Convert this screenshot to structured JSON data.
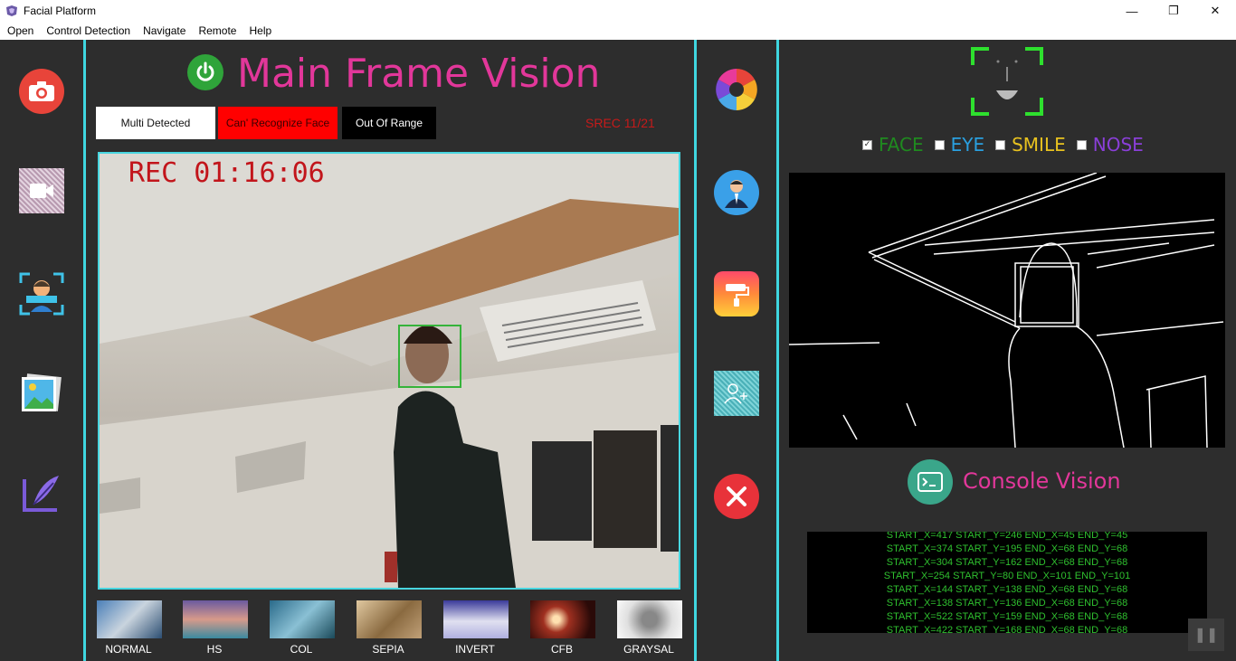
{
  "window": {
    "title": "Facial Platform",
    "minimize": "—",
    "maximize": "❐",
    "close": "✕"
  },
  "menu": [
    "Open",
    "Control Detection",
    "Navigate",
    "Remote",
    "Help"
  ],
  "main": {
    "title": "Main Frame Vision",
    "status": {
      "multi": "Multi Detected",
      "cant": "Can' Recognize Face",
      "range": "Out Of Range"
    },
    "srec": "SREC 11/21",
    "rec": "REC 01:16:06"
  },
  "filters": [
    "NORMAL",
    "HS",
    "COL",
    "SEPIA",
    "INVERT",
    "CFB",
    "GRAYSAL"
  ],
  "right": {
    "checks": [
      {
        "label": "FACE",
        "checked": true,
        "color": "#1f8a1f"
      },
      {
        "label": "EYE",
        "checked": false,
        "color": "#2aa0e0"
      },
      {
        "label": "SMILE",
        "checked": false,
        "color": "#e8c21f"
      },
      {
        "label": "NOSE",
        "checked": false,
        "color": "#8a3fd8"
      }
    ],
    "console_title": "Console Vision",
    "console_lines": [
      "START_X=417 START_Y=246 END_X=45 END_Y=45",
      "START_X=374 START_Y=195 END_X=68 END_Y=68",
      "START_X=304 START_Y=162 END_X=68 END_Y=68",
      "START_X=254 START_Y=80 END_X=101 END_Y=101",
      "START_X=144 START_Y=138 END_X=68 END_Y=68",
      "START_X=138 START_Y=136 END_X=68 END_Y=68",
      "START_X=522 START_Y=159 END_X=68 END_Y=68",
      "START_X=422 START_Y=168 END_X=68 END_Y=68"
    ]
  },
  "colors": {
    "accent": "#e2379a",
    "separator": "#3fd6e0",
    "panel": "#2d2d2d"
  }
}
